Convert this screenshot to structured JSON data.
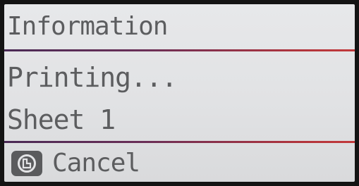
{
  "screen": {
    "title": "Information",
    "status": "Printing...",
    "sheet": "Sheet 1"
  },
  "footer": {
    "cancel_label": "Cancel",
    "cancel_icon": "stop-icon"
  },
  "colors": {
    "lcd_background": "#e3e4e6",
    "text": "#5c5d5f",
    "divider_start": "#4a2a55",
    "divider_end": "#c23a3c"
  }
}
